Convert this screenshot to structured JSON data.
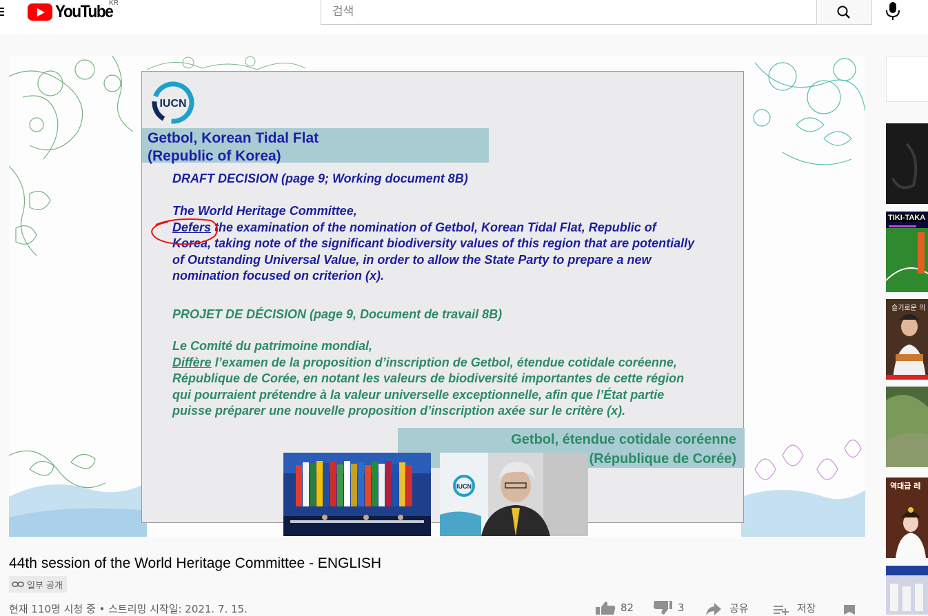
{
  "header": {
    "logo_text": "YouTube",
    "country_code": "KR",
    "search_placeholder": "검색"
  },
  "slide": {
    "org_logo_text": "IUCN",
    "title_line1": "Getbol, Korean Tidal Flat",
    "title_line2": "(Republic of Korea)",
    "draft_heading": "DRAFT DECISION (page 9; Working document 8B)",
    "en_committee": "The World Heritage Committee,",
    "en_defers": "Defers",
    "en_line1_rest": " the examination of the nomination of Getbol, Korean Tidal Flat, Republic of",
    "en_line2": "Korea, taking note of the significant biodiversity values of this region that are potentially",
    "en_line3": "of Outstanding Universal Value, in order to allow the State Party to prepare a new",
    "en_line4": "nomination focused on criterion (x).",
    "projet_heading": "PROJET DE DÉCISION (page 9, Document de travail 8B)",
    "fr_committee": "Le Comité du patrimoine mondial,",
    "fr_differe": "Diffère",
    "fr_line1_rest": " l’examen de la proposition d’inscription de Getbol, étendue cotidale coréenne,",
    "fr_line2": "République de Corée, en notant les valeurs de biodiversité importantes de cette région",
    "fr_line3": "qui pourraient prétendre à la valeur universelle exceptionnelle, afin que l’État partie",
    "fr_line4": "puisse préparer une nouvelle proposition d’inscription axée sur le critère (x).",
    "footer_line1": "Getbol, étendue cotidale coréenne",
    "footer_line2": "(République de Corée)",
    "speaker_logo_text": "IUCN"
  },
  "video": {
    "title": "44th session of the World Heritage Committee - ENGLISH",
    "privacy": "일부 공개",
    "meta": "현재 110명 시청 중 • 스트리밍 시작일: 2021. 7. 15.",
    "likes": "82",
    "dislikes": "3",
    "share_label": "공유",
    "save_label": "저장"
  },
  "sidebar": {
    "thumb2_label": "TIKI-TAKA",
    "thumb3_label": "슬기로운 의",
    "thumb5_label": "역대급 레"
  },
  "colors": {
    "brand": "#ff0000",
    "slide_blue": "#1b1e9c",
    "slide_green": "#2c8a67",
    "slide_band": "#a9ccd2"
  }
}
